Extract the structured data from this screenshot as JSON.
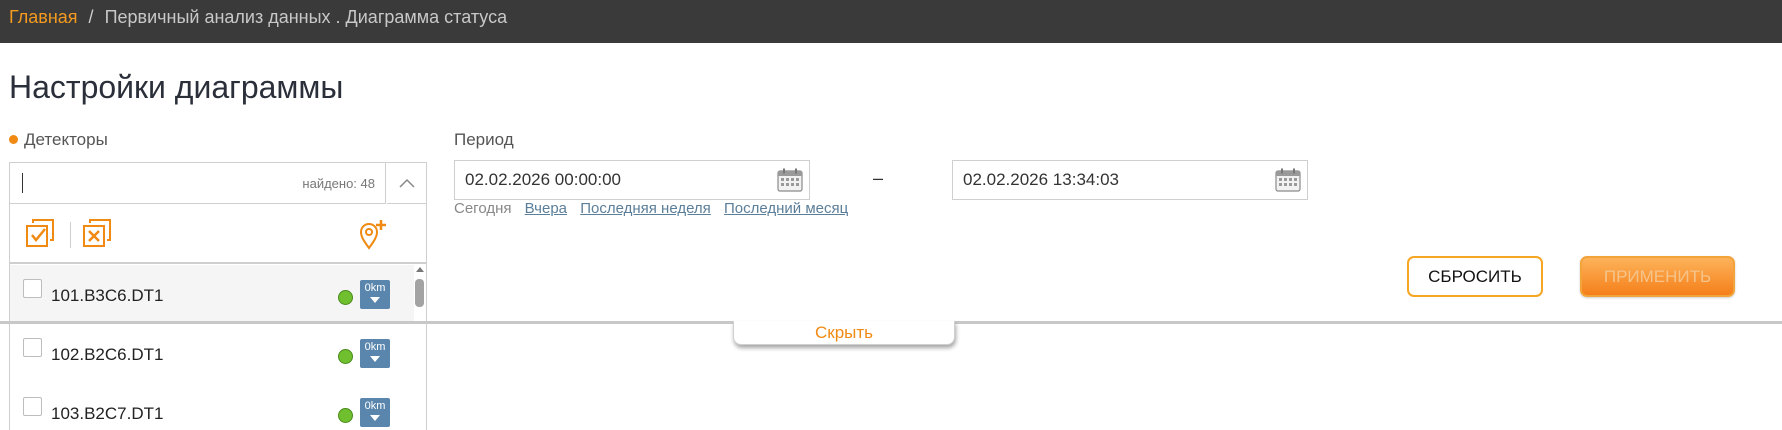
{
  "breadcrumb": {
    "home": "Главная",
    "separator": "/",
    "current": "Первичный анализ данных . Диаграмма статуса"
  },
  "page_title": "Настройки диаграммы",
  "detectors": {
    "label": "Детекторы",
    "search_value": "",
    "found_text": "найдено: 48",
    "items": [
      {
        "name": "101.B3C6.DT1",
        "km": "0km",
        "checked": false
      },
      {
        "name": "102.B2C6.DT1",
        "km": "0km",
        "checked": false
      },
      {
        "name": "103.B2C7.DT1",
        "km": "0km",
        "checked": false
      }
    ]
  },
  "period": {
    "label": "Период",
    "from": "02.02.2026 00:00:00",
    "dash": "–",
    "to": "02.02.2026 13:34:03",
    "quick_links": [
      "Сегодня",
      "Вчера",
      "Последняя неделя",
      "Последний месяц"
    ]
  },
  "actions": {
    "reset": "СБРОСИТЬ",
    "apply": "ПРИМЕНИТЬ"
  },
  "hide_label": "Скрыть",
  "colors": {
    "accent": "#f08a12",
    "topbar": "#3a3a3a",
    "status_ok": "#6fbf2e",
    "km_badge": "#5a86ad"
  },
  "icons": {
    "select_all": "select-all-icon",
    "deselect_all": "deselect-all-icon",
    "add_location": "add-location-icon",
    "calendar": "calendar-icon",
    "collapse": "chevron-up-icon"
  }
}
